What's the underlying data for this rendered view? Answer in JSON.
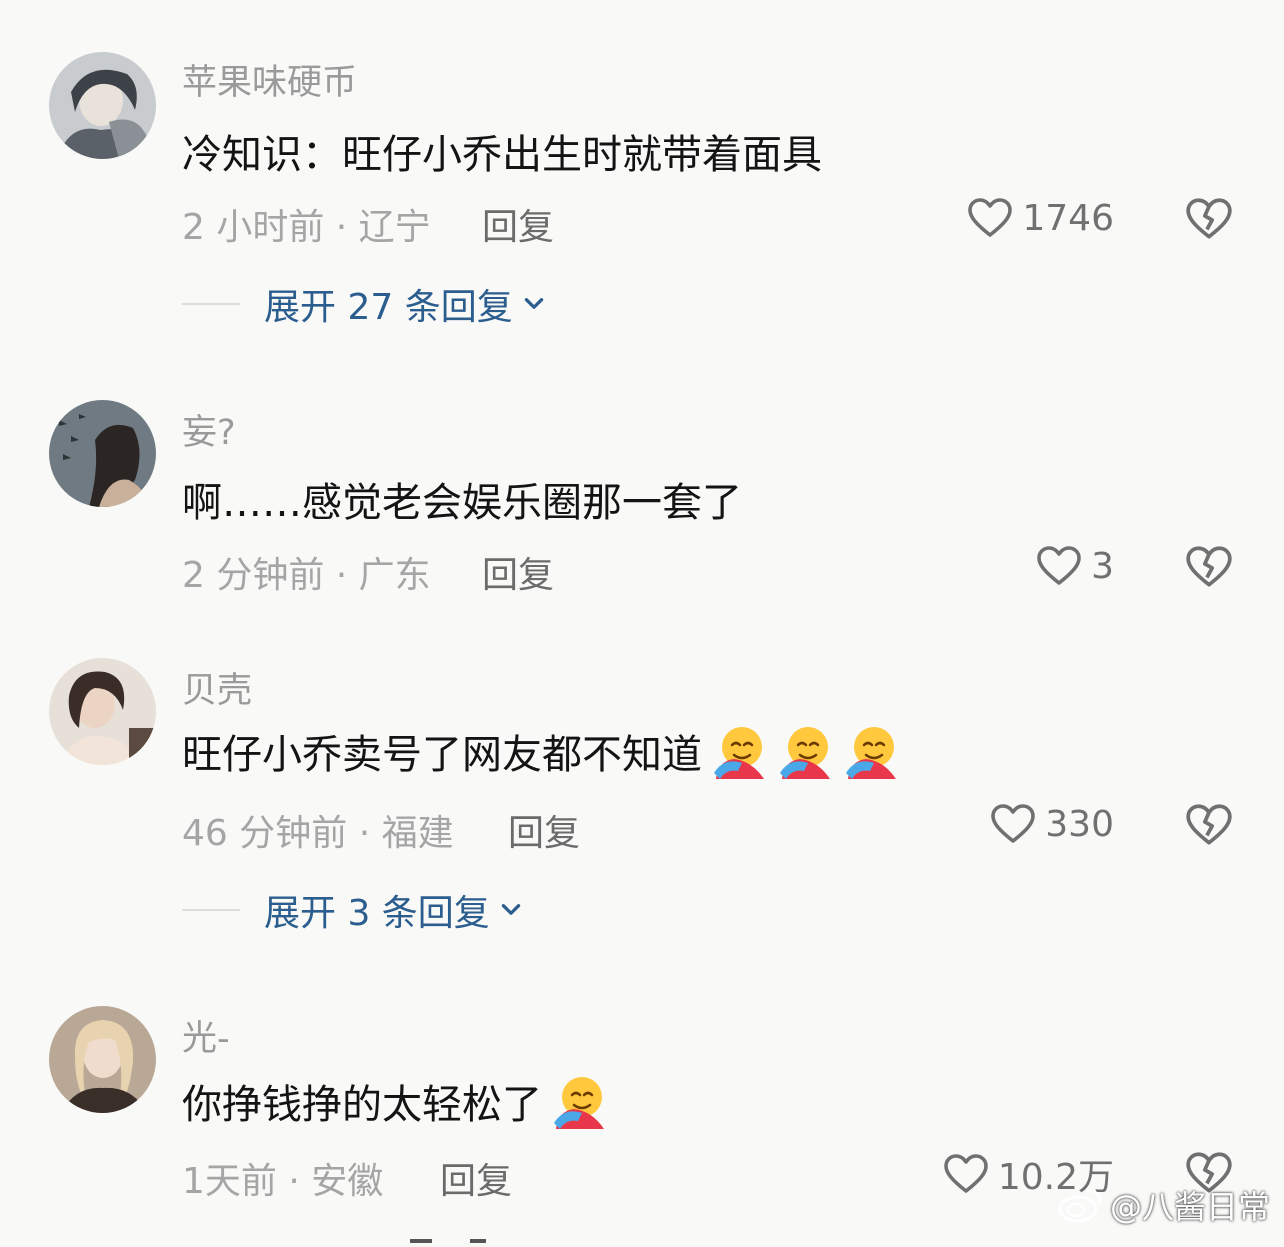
{
  "comments": [
    {
      "username": "苹果味硬币",
      "text": "冷知识：旺仔小乔出生时就带着面具",
      "meta": "2 小时前 · 辽宁",
      "reply_label": "回复",
      "likes": "1746",
      "expand_label": "展开 27 条回复"
    },
    {
      "username": "妄?",
      "text": "啊……感觉老会娱乐圈那一套了",
      "meta": "2 分钟前 · 广东",
      "reply_label": "回复",
      "likes": "3"
    },
    {
      "username": "贝壳",
      "text": "旺仔小乔卖号了网友都不知道",
      "emoji_count": 3,
      "meta": "46 分钟前 · 福建",
      "reply_label": "回复",
      "likes": "330",
      "expand_label": "展开 3 条回复"
    },
    {
      "username": "光-",
      "text": "你挣钱挣的太轻松了",
      "emoji_count": 1,
      "meta": "1天前 · 安徽",
      "reply_label": "回复",
      "likes": "10.2万"
    }
  ],
  "icons": {
    "like": "heart-outline-icon",
    "dislike": "broken-heart-icon",
    "expand": "chevron-down-icon",
    "emoji": "hugging-face-emoji"
  },
  "colors": {
    "background": "#f9f9f7",
    "expand_link": "#2b5d8e",
    "secondary_text": "#a5a5a5"
  },
  "watermark": {
    "text": "@八酱日常",
    "icon": "weibo-logo-icon"
  }
}
